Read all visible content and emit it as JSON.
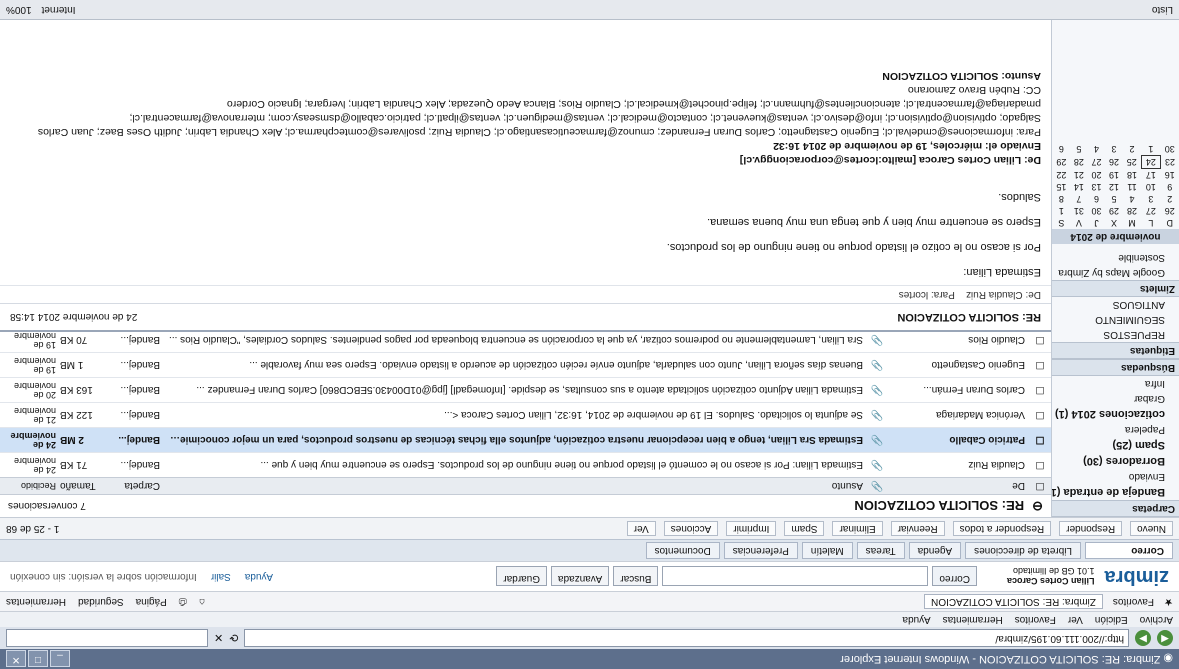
{
  "window": {
    "title": "Zimbra: RE: SOLICITA COTIZACION - Windows Internet Explorer"
  },
  "address": {
    "url": "http://200.111.60.195/zimbra/",
    "search_placeholder": ""
  },
  "menu": [
    "Archivo",
    "Edición",
    "Ver",
    "Favoritos",
    "Herramientas",
    "Ayuda"
  ],
  "favorites": {
    "label": "Favoritos",
    "tab": "Zimbra: RE: SOLICITA COTIZACION",
    "tools": [
      "Página",
      "Seguridad",
      "Herramientas"
    ]
  },
  "zimbra": {
    "logo": "zimbra",
    "user": "Lilian Cortes Caroca",
    "quota": "1.01 GB de Ilimitado",
    "search_type": "Correo",
    "search_button": "Buscar",
    "advanced": "Avanzada",
    "saved": "Guardar",
    "help": "Ayuda",
    "logout": "Salir",
    "notice": "Información sobre la versión: sin conexión"
  },
  "apptabs": [
    "Correo",
    "Libreta de direcciones",
    "Agenda",
    "Tareas",
    "Maletín",
    "Preferencias",
    "Documentos"
  ],
  "toolbar": {
    "new": "Nuevo",
    "reply": "Responder",
    "reply_all": "Responder a todos",
    "forward": "Reenviar",
    "delete": "Eliminar",
    "spam": "Spam",
    "print": "Imprimir",
    "actions": "Acciones",
    "view": "Ver",
    "pager": "1 - 25 de 68"
  },
  "left": {
    "folders_title": "Carpetas",
    "folders": [
      "Bandeja de entrada (1)",
      "Enviado",
      "Borradores (30)",
      "Spam (25)",
      "Papelera",
      "cotizaciones 2014 (1)",
      "Grabar",
      "Infra"
    ],
    "searches_title": "Búsquedas",
    "tags_title": "Etiquetas",
    "tags": [
      "REPUESTOS",
      "SEGUIMIENTO",
      "ANTIGUOS"
    ],
    "zimlets_title": "Zimlets",
    "zimlets": [
      "Google Maps by Zimbra",
      "Sostenible"
    ],
    "calendar": {
      "month": "noviembre de 2014",
      "days": [
        "D",
        "L",
        "M",
        "X",
        "J",
        "V",
        "S"
      ],
      "weeks": [
        [
          "26",
          "27",
          "28",
          "29",
          "30",
          "31",
          "1"
        ],
        [
          "2",
          "3",
          "4",
          "5",
          "6",
          "7",
          "8"
        ],
        [
          "9",
          "10",
          "11",
          "12",
          "13",
          "14",
          "15"
        ],
        [
          "16",
          "17",
          "18",
          "19",
          "20",
          "21",
          "22"
        ],
        [
          "23",
          "24",
          "25",
          "26",
          "27",
          "28",
          "29"
        ],
        [
          "30",
          "1",
          "2",
          "3",
          "4",
          "5",
          "6"
        ]
      ]
    }
  },
  "list": {
    "title": "RE: SOLICITA COTIZACION",
    "count": "7 conversaciones",
    "headers": {
      "from": "De",
      "subject": "Asunto",
      "folder": "Carpeta",
      "size": "Tamaño",
      "date": "Recibido"
    },
    "rows": [
      {
        "from": "Claudia Ruiz",
        "subject": "Estimada Lilian: Por si acaso no le comentó el listado porque no tiene ninguno de los productos. Espero se encuentre muy bien y que ...",
        "folder": "Bandej...",
        "size": "71 KB",
        "date": "24 de noviembre",
        "selected": false,
        "unread": false
      },
      {
        "from": "Patricio Caballo",
        "subject": "Estimada Sra Lilian, tengo a bien recepcionar nuestra cotización, adjuntos ella fichas técnicas de nuestros productos, para un mejor conocimiento...",
        "folder": "Bandej...",
        "size": "2 MB",
        "date": "24 de noviembre",
        "selected": true,
        "unread": true
      },
      {
        "from": "Verónica Madariaga",
        "subject": "Se adjunta lo solicitado. Saludos. El 19 de noviembre de 2014, 16:32, Lilian Cortes Caroca <...",
        "folder": "Bandej...",
        "size": "122 KB",
        "date": "21 de noviembre",
        "selected": false,
        "unread": false
      },
      {
        "from": "Carlos Duran Fernán...",
        "subject": "Estimada Lilian Adjunto cotización solicitada atento a sus consultas, se despide. [Infomegadl] [jpg@01D00430.5EBCD860] Carlos Duran Fernandez ...",
        "folder": "Bandej...",
        "size": "163 KB",
        "date": "20 de noviembre",
        "selected": false,
        "unread": false
      },
      {
        "from": "Eugenio Castagnetto",
        "subject": "Buenas días señora Lilian, Junto con saludarla, adjunto envíe recién cotización de acuerdo a listado enviado. Espero sea muy favorable ...",
        "folder": "Bandej...",
        "size": "1 MB",
        "date": "19 de noviembre",
        "selected": false,
        "unread": false
      },
      {
        "from": "Claudio Rios",
        "subject": "Sra Lilian, Lamentablemente no podremos cotizar, ya que la corporación se encuentra bloqueada por pagos pendientes. Saludos Cordiales, \"Claudio Rios ...",
        "folder": "Bandej...",
        "size": "70 KB",
        "date": "19 de noviembre",
        "selected": false,
        "unread": false
      }
    ]
  },
  "reading": {
    "subject": "RE: SOLICITA COTIZACION",
    "date": "24 de noviembre 2014 14:58",
    "from_label": "De:",
    "from": "Claudia Ruiz",
    "to_label": "Para:",
    "to": "lcortes",
    "body": [
      "Estimada Lilian:",
      "Por si acaso no le cotizo el listado porque no tiene ninguno de los productos.",
      "Espero se encuentre muy bien y que tenga una muy buena semana.",
      "Saludos."
    ],
    "fwd_from": "De: Lilian Cortes Caroca [mailto:lcortes@corporacionggv.cl]",
    "fwd_sent": "Enviado el: miércoles, 19 de noviembre de 2014 16:32",
    "fwd_to": "Para: informaciones@cmdelval.cl; Eugenio Castagnetto; Carlos Duran Fernandez; cmunoz@farmaceuticasantiago.cl; Claudia Ruiz; psolivares@comtecpharma.cl; Alex Chandia Labrin; Judith Oses Baez; Juan Carlos Salgado; optivision@optivision.cl; info@desivo.cl; ventas@kuevenet.cl; contacto@medical.cl; ventas@mediguen.cl; ventas@ilpatl.cl; patricio.caballo@dsmseasy.com; mterranova@farmacentral.cl; pmadariaga@farmacentral.cl; atencionclientes@fuhmann.cl; felipe.pinochet@kmedical.cl; Claudio Rios; Blanca Aedo Quezada; Alex Chandia Labrin; lvergara; Ignacio Cordero",
    "fwd_cc": "CC: Rubén Bravo Zamorano",
    "fwd_subject": "Asunto: SOLICITA COTIZACION"
  },
  "status": {
    "left": "Listo",
    "zone": "Internet",
    "zoom": "100%"
  }
}
